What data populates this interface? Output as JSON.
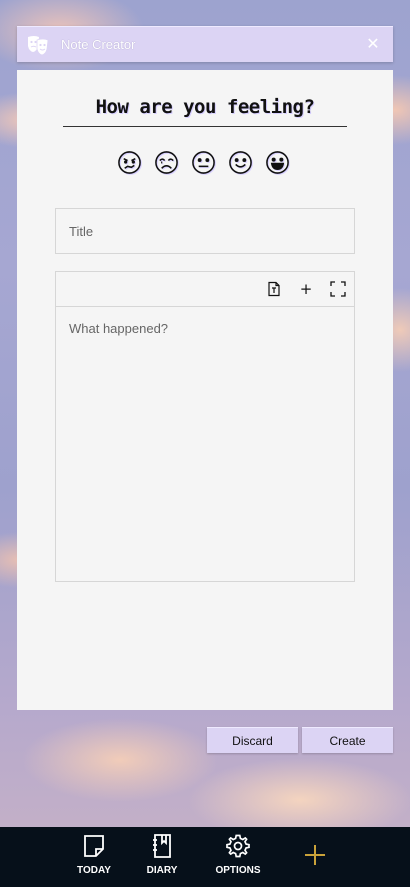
{
  "window": {
    "title": "Note Creator",
    "icon": "theater-masks-icon",
    "close_glyph": "✕"
  },
  "panel": {
    "heading": "How are you feeling?",
    "moods": [
      {
        "name": "mood-angry-icon"
      },
      {
        "name": "mood-sad-icon"
      },
      {
        "name": "mood-neutral-icon"
      },
      {
        "name": "mood-happy-icon"
      },
      {
        "name": "mood-very-happy-icon"
      }
    ],
    "title_field": {
      "placeholder": "Title",
      "value": ""
    },
    "body_field": {
      "placeholder": "What happened?",
      "value": ""
    },
    "toolbar": {
      "items": [
        "text-file-icon",
        "plus-icon",
        "fullscreen-icon"
      ],
      "plus_glyph": "+"
    }
  },
  "actions": {
    "discard_label": "Discard",
    "create_label": "Create"
  },
  "nav": {
    "today_label": "TODAY",
    "diary_label": "DIARY",
    "options_label": "OPTIONS"
  },
  "colors": {
    "accent": "#dcd4f4",
    "panel": "#f5f5f5",
    "nav_background": "#06101a",
    "add_button": "#c9a23a"
  }
}
